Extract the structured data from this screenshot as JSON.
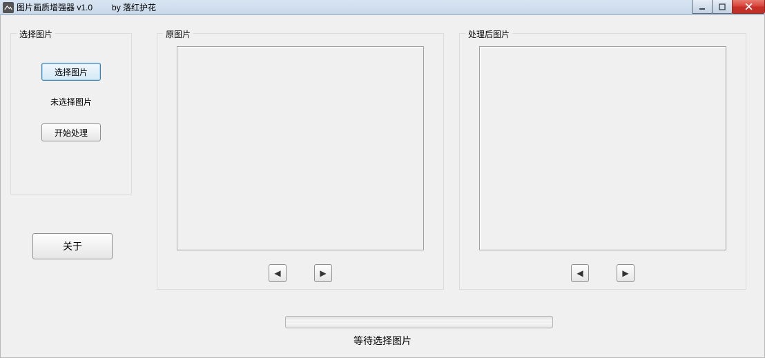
{
  "window": {
    "title": "图片画质增强器 v1.0",
    "author": "by 落红护花"
  },
  "sidebar": {
    "group_label": "选择图片",
    "select_button": "选择图片",
    "no_selection_label": "未选择图片",
    "process_button": "开始处理"
  },
  "about_button": "关于",
  "panels": {
    "original_label": "原图片",
    "processed_label": "处理后图片"
  },
  "arrows": {
    "left": "◀",
    "right": "▶"
  },
  "status_text": "等待选择图片",
  "progress_value": 0
}
